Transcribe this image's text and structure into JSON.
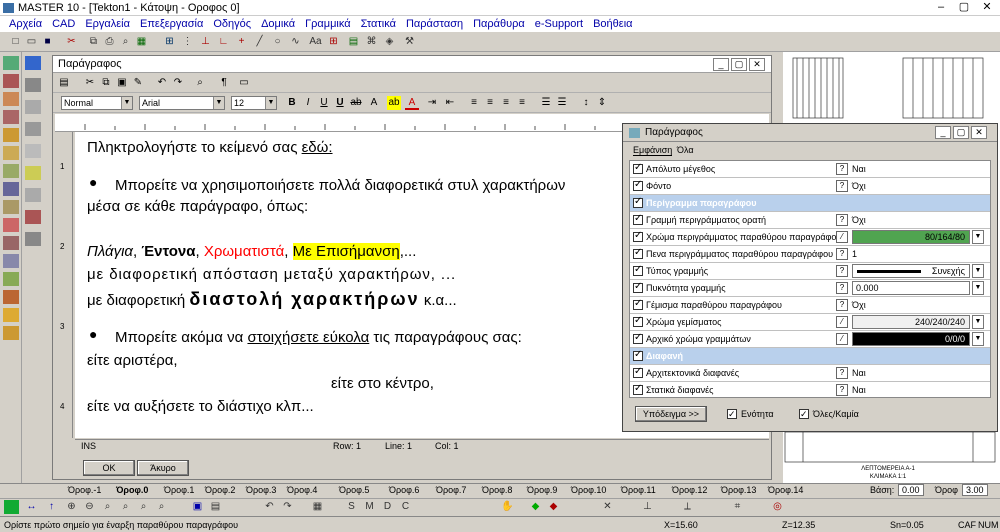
{
  "window": {
    "title": "MASTER 10 - [Tekton1 - Κάτοψη - Οροφος 0]"
  },
  "menu": [
    "Αρχεία",
    "CAD",
    "Εργαλεία",
    "Επεξεργασία",
    "Οδηγός",
    "Δομικά",
    "Γραμμικά",
    "Στατικά",
    "Παράσταση",
    "Παράθυρα",
    "e-Support",
    "Βοήθεια"
  ],
  "editor": {
    "title": "Παράγραφος",
    "style": "Normal",
    "font": "Arial",
    "size": "12",
    "lines": {
      "l1a": "Πληκτρολογήστε το κείμενό σας ",
      "l1b": "εδώ:",
      "l2": "Μπορείτε να χρησιμοποιήσετε πολλά διαφορετικά στυλ χαρακτήρων",
      "l3": "μέσα σε κάθε παράγραφο, όπως:",
      "l4a": "Πλάγια",
      "l4b": ", ",
      "l4c": "Έντονα",
      "l4d": ", ",
      "l4e": "Χρωματιστά",
      "l4f": ", ",
      "l4g": "Με Επισήμανση",
      "l4h": ",...",
      "l5": "με διαφορετική απόσταση μεταξύ χαρακτήρων, ...",
      "l6a": "με διαφορετική ",
      "l6b": "διαστολή χαρακτήρων",
      "l6c": " κ.α...",
      "l7a": "Μπορείτε ακόμα να ",
      "l7b": "στοιχήσετε εύκολα",
      "l7c": " τις παραγράφους σας:",
      "l8": "είτε αριστέρα,",
      "l9": "είτε στο κέντρο,",
      "l10": "είτε να αυξήσετε το διάστιχο κλπ..."
    },
    "status": {
      "mode": "INS",
      "row": "Row: 1",
      "line": "Line: 1",
      "col": "Col: 1"
    },
    "ok": "OK",
    "cancel": "Άκυρο",
    "ruler_v": [
      "1",
      "2",
      "3",
      "4"
    ]
  },
  "props": {
    "title": "Παράγραφος",
    "tab1": "Εμφάνιση",
    "tab2": "Όλα",
    "rows": [
      {
        "label": "Απόλυτο μέγεθος",
        "value": "Ναι"
      },
      {
        "label": "Φόντο",
        "value": "Όχι"
      },
      {
        "label": "Περίγραμμα παραγράφου",
        "section": true
      },
      {
        "label": "Γραμμή περιγράμματος ορατή",
        "value": "Όχι"
      },
      {
        "label": "Χρώμα περιγράμματος παραθύρου παραγράφου",
        "value": "80/164/80"
      },
      {
        "label": "Πενα περιγράμματος παραθύρου παραγράφου",
        "value": "1"
      },
      {
        "label": "Τύπος γραμμής",
        "value": "Συνεχής"
      },
      {
        "label": "Πυκνότητα γραμμής",
        "value": "0.000"
      },
      {
        "label": "Γέμισμα παραθύρου παραγράφου",
        "value": "Όχι"
      },
      {
        "label": "Χρώμα γεμίσματος",
        "value": "240/240/240"
      },
      {
        "label": "Αρχικό χρώμα γραμμάτων",
        "value": "0/0/0"
      },
      {
        "label": "Διαφανή",
        "section": true
      },
      {
        "label": "Αρχιτεκτονικά διαφανές",
        "value": "Ναι"
      },
      {
        "label": "Στατικά διαφανές",
        "value": "Ναι"
      }
    ],
    "example_btn": "Υπόδειγμα >>",
    "unity": "Ενότητα",
    "all_none": "Όλες/Καμία"
  },
  "floors": [
    "Όροφ.-1",
    "Όροφ.0",
    "Όροφ.1",
    "Όροφ.2",
    "Όροφ.3",
    "Όροφ.4",
    "Όροφ.5",
    "Όροφ.6",
    "Όροφ.7",
    "Όροφ.8",
    "Όροφ.9",
    "Όροφ.10",
    "Όροφ.11",
    "Όροφ.12",
    "Όροφ.13",
    "Όροφ.14"
  ],
  "bottom": {
    "base_label": "Βάση:",
    "base_val": "0.00",
    "ceil_label": "Όροφ",
    "ceil_val": "3.00"
  },
  "drawing": {
    "label1": "ΛΕΠΤΟΜΕΡΕΙΑ Α-1",
    "label2": "ΚΛΙΜΑΚΑ 1:1"
  },
  "status": {
    "hint": "Ορίστε πρώτο σημείο για έναρξη παραθύρου παραγράφου",
    "x": "X=15.60",
    "z": "Z=12.35",
    "sn": "Sn=0.05",
    "caf": "CAF",
    "num": "NUM"
  },
  "colors": {
    "border_green": "#50a450",
    "fill": "#f0f0f0",
    "text_black": "#000000",
    "highlight": "#ffff00",
    "red": "#ff0000"
  }
}
